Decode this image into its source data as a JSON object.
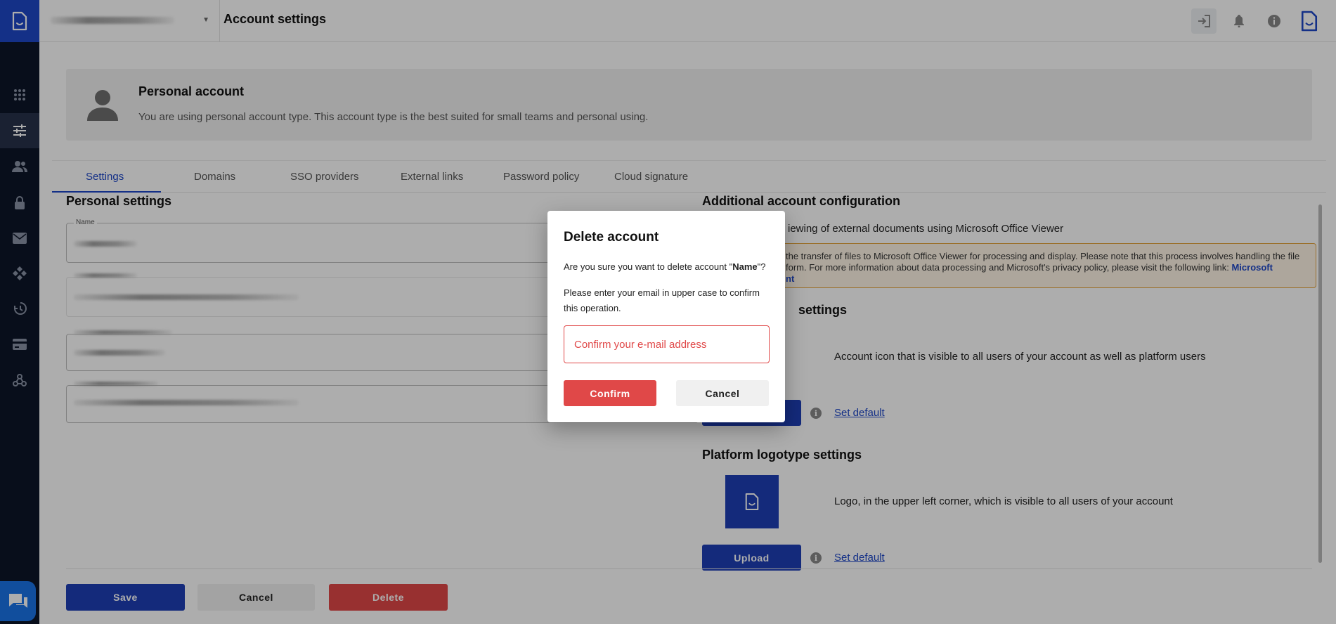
{
  "header": {
    "page_title": "Account settings"
  },
  "banner": {
    "title": "Personal account",
    "description": "You are using personal account type. This account type is the best suited for small teams and personal using."
  },
  "tabs": [
    {
      "label": "Settings",
      "active": true
    },
    {
      "label": "Domains"
    },
    {
      "label": "SSO providers"
    },
    {
      "label": "External links"
    },
    {
      "label": "Password policy"
    },
    {
      "label": "Cloud signature"
    }
  ],
  "personal_settings": {
    "title": "Personal settings",
    "name_label": "Name"
  },
  "additional_config": {
    "title": "Additional account configuration",
    "viewer_text": "iewing of external documents using Microsoft Office Viewer",
    "warning_line1": "the transfer of files to Microsoft Office Viewer for processing and display. Please note that this process involves handling the file",
    "warning_line2": "form. For more information about data processing and Microsoft's privacy policy, please visit the following link: ",
    "warning_link_part1": "Microsoft",
    "warning_link_part2": "nt"
  },
  "icon_settings": {
    "title_fragment": "settings",
    "description": "Account icon that is visible to all users of your account as well as platform users",
    "set_default": "Set default"
  },
  "logotype_settings": {
    "title": "Platform logotype settings",
    "description": "Logo, in the upper left corner, which is visible to all users of your account",
    "upload": "Upload",
    "set_default": "Set default"
  },
  "footer": {
    "save": "Save",
    "cancel": "Cancel",
    "delete": "Delete"
  },
  "modal": {
    "title": "Delete account",
    "question_prefix": "Are you sure you want to delete account \"",
    "account_name": "Name",
    "question_suffix": "\"?",
    "note": "Please enter your email in upper case to confirm this operation.",
    "input_placeholder": "Confirm your e-mail address",
    "confirm": "Confirm",
    "cancel": "Cancel"
  },
  "colors": {
    "brand_blue": "#1e47c8",
    "danger_red": "#e04848",
    "rail_bg": "#0c1528",
    "warning_border": "#e5a640"
  },
  "icons": {
    "rail": [
      "document-logo-icon",
      "apps-grid-icon",
      "sliders-icon",
      "users-icon",
      "lock-icon",
      "mail-icon",
      "workflow-icon",
      "history-icon",
      "credit-card-icon",
      "webhook-icon",
      "chat-icon"
    ],
    "top": [
      "sign-out-icon",
      "bell-icon",
      "info-icon",
      "document-logo-icon"
    ]
  }
}
